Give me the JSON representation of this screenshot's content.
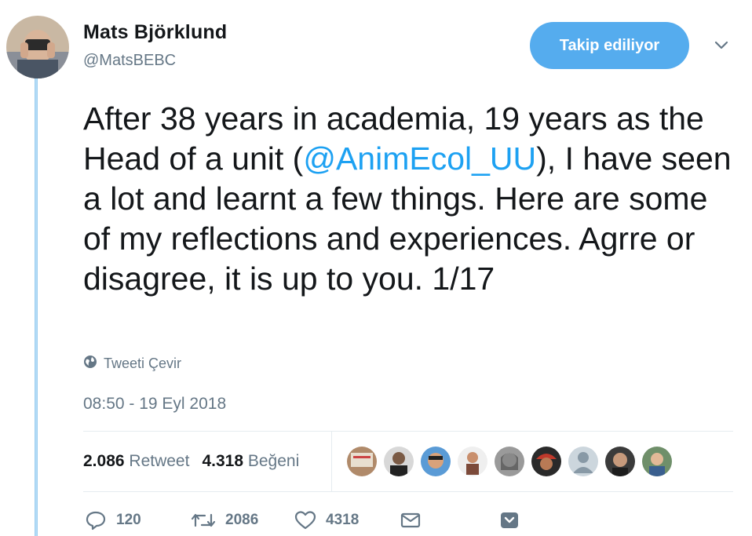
{
  "user": {
    "name": "Mats Björklund",
    "handle": "@MatsBEBC"
  },
  "follow_button": {
    "label": "Takip ediliyor"
  },
  "tweet": {
    "text_before": "After 38 years in academia, 19 years as the Head of a unit (",
    "mention": "@AnimEcol_UU",
    "text_after": "), I have seen a lot and learnt a few things. Here are some of my reflections and experiences. Agrre or disagree, it is up to you. 1/17",
    "translate_label": "Tweeti Çevir",
    "timestamp": "08:50 - 19 Eyl 2018"
  },
  "stats": {
    "retweets_count": "2.086",
    "retweets_label": "Retweet",
    "likes_count": "4.318",
    "likes_label": "Beğeni"
  },
  "actions": {
    "reply_count": "120",
    "retweet_count": "2086",
    "like_count": "4318"
  },
  "icons": {
    "globe": "globe-icon",
    "caret": "chevron-down-icon",
    "reply": "reply-icon",
    "retweet": "retweet-icon",
    "like": "heart-icon",
    "dm": "envelope-icon",
    "bookmark": "bookmark-icon"
  },
  "colors": {
    "accent": "#1da1f2",
    "button": "#55acee",
    "muted": "#657786",
    "thread_line": "#b5dcf7"
  }
}
